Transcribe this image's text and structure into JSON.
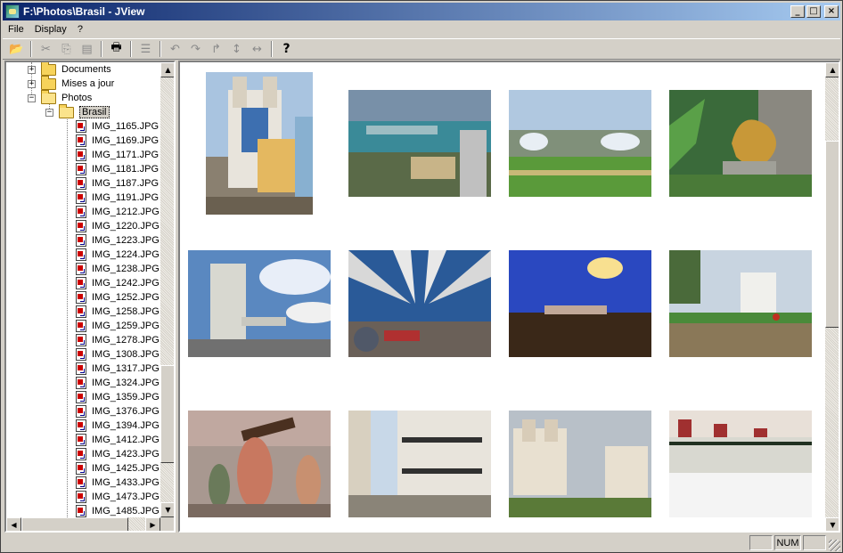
{
  "window": {
    "title": "F:\\Photos\\Brasil - JView"
  },
  "titlebar_controls": {
    "minimize": "_",
    "maximize": "□",
    "close": "×"
  },
  "menu": [
    {
      "label": "File"
    },
    {
      "label": "Display"
    },
    {
      "label": "?"
    }
  ],
  "toolbar": {
    "open_glyph": "📂",
    "cut_glyph": "✂",
    "copy_glyph": "⎘",
    "paste_glyph": "▤",
    "print_glyph": "🖶",
    "list_glyph": "☰",
    "rotate_left_glyph": "↶",
    "rotate_right_glyph": "↷",
    "flip_glyph": "↱",
    "vertical_glyph": "↕",
    "horizontal_glyph": "↔",
    "help_glyph": "?"
  },
  "tree": {
    "folders": [
      {
        "label": "Documents",
        "expander": "+"
      },
      {
        "label": "Mises a jour",
        "expander": "+"
      },
      {
        "label": "Photos",
        "expander": "−"
      }
    ],
    "subfolder": {
      "label": "Brasil",
      "expander": "−"
    },
    "files": [
      "IMG_1165.JPG",
      "IMG_1169.JPG",
      "IMG_1171.JPG",
      "IMG_1181.JPG",
      "IMG_1187.JPG",
      "IMG_1191.JPG",
      "IMG_1212.JPG",
      "IMG_1220.JPG",
      "IMG_1223.JPG",
      "IMG_1224.JPG",
      "IMG_1238.JPG",
      "IMG_1242.JPG",
      "IMG_1252.JPG",
      "IMG_1258.JPG",
      "IMG_1259.JPG",
      "IMG_1278.JPG",
      "IMG_1308.JPG",
      "IMG_1317.JPG",
      "IMG_1324.JPG",
      "IMG_1359.JPG",
      "IMG_1376.JPG",
      "IMG_1394.JPG",
      "IMG_1412.JPG",
      "IMG_1423.JPG",
      "IMG_1425.JPG",
      "IMG_1433.JPG",
      "IMG_1473.JPG",
      "IMG_1485.JPG"
    ]
  },
  "scroll": {
    "up": "▲",
    "down": "▼",
    "left": "◀",
    "right": "▶"
  },
  "statusbar": {
    "num": "NUM"
  },
  "colors": {
    "title_start": "#0a246a",
    "title_end": "#a6caf0",
    "face": "#d4d0c8"
  }
}
